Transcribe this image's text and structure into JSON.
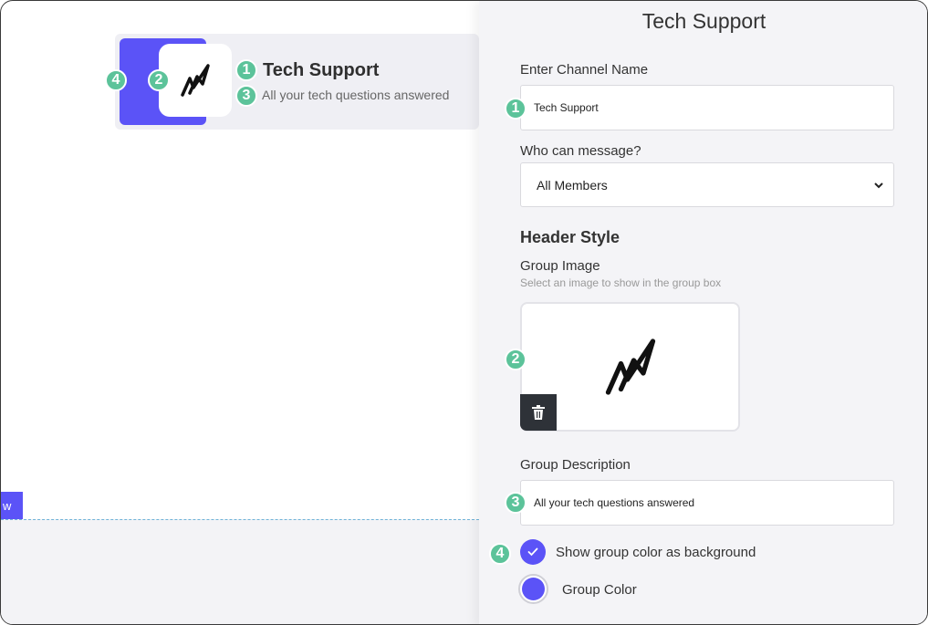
{
  "preview": {
    "edge_tab_label": "w",
    "card": {
      "title": "Tech Support",
      "description": "All your tech questions answered"
    },
    "badges": {
      "one": "1",
      "two": "2",
      "three": "3",
      "four": "4"
    }
  },
  "panel": {
    "title": "Tech Support",
    "channel_name": {
      "label": "Enter Channel Name",
      "value": "Tech Support"
    },
    "who_can_message": {
      "label": "Who can message?",
      "selected": "All Members"
    },
    "header_style": {
      "heading": "Header Style"
    },
    "group_image": {
      "label": "Group Image",
      "hint": "Select an image to show in the group box"
    },
    "group_description": {
      "label": "Group Description",
      "value": "All your tech questions answered"
    },
    "show_group_color": {
      "label": "Show group color as background",
      "checked": true
    },
    "group_color": {
      "label": "Group Color",
      "value": "#5b53f7"
    }
  },
  "icons": {
    "logo": "lightning-scribble-icon",
    "trash": "trash-icon",
    "check": "check-icon",
    "chevron": "chevron-down-icon"
  },
  "colors": {
    "accent": "#5b53f7",
    "badge": "#5cc39a"
  }
}
